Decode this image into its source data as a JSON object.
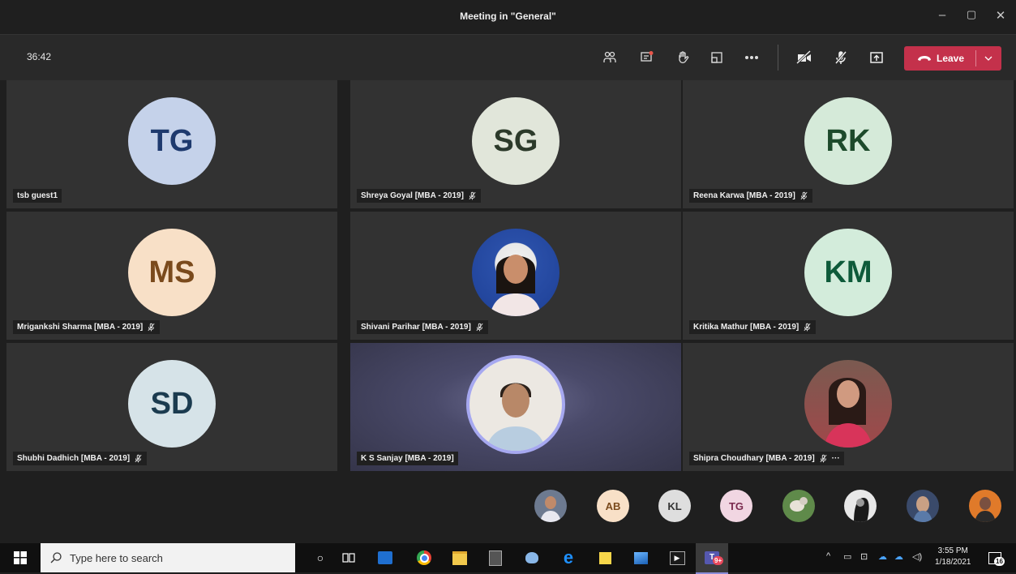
{
  "window": {
    "title": "Meeting in \"General\""
  },
  "toolbar": {
    "timer": "36:42",
    "leave_label": "Leave"
  },
  "tiles": [
    {
      "name": "tsb guest1",
      "initials": "TG",
      "bg": "#c5d2ea",
      "fg": "#1e3a6e",
      "muted": false
    },
    {
      "name": "Shreya Goyal [MBA - 2019]",
      "initials": "SG",
      "bg": "#e1e6da",
      "fg": "#2c3a2a",
      "muted": true
    },
    {
      "name": "Reena Karwa [MBA - 2019]",
      "initials": "RK",
      "bg": "#d5ead9",
      "fg": "#1d4a2b",
      "muted": true
    },
    {
      "name": "Mrigankshi Sharma [MBA - 2019]",
      "initials": "MS",
      "bg": "#f8e0c7",
      "fg": "#7a4a1c",
      "muted": true
    },
    {
      "name": "Shivani Parihar [MBA - 2019]",
      "initials": "",
      "photo": "woman-blue",
      "muted": true
    },
    {
      "name": "Kritika Mathur [MBA - 2019]",
      "initials": "KM",
      "bg": "#d3ecdb",
      "fg": "#0e5a3a",
      "muted": true
    },
    {
      "name": "Shubhi Dadhich [MBA - 2019]",
      "initials": "SD",
      "bg": "#d6e3e8",
      "fg": "#1b3b4f",
      "muted": true
    },
    {
      "name": "K S Sanjay [MBA - 2019]",
      "initials": "",
      "photo": "man-speaker",
      "muted": false
    },
    {
      "name": "Shipra Choudhary [MBA - 2019]",
      "initials": "",
      "photo": "woman-red",
      "muted": true,
      "more": "···"
    }
  ],
  "strip": [
    {
      "initials": "",
      "photo": "person-photo-1"
    },
    {
      "initials": "AB",
      "bg": "#f8e0c7",
      "fg": "#7a4a1c"
    },
    {
      "initials": "KL",
      "bg": "#dedede",
      "fg": "#333333"
    },
    {
      "initials": "TG",
      "bg": "#f1d6e2",
      "fg": "#7a2a4e"
    },
    {
      "initials": "",
      "photo": "person-photo-2"
    },
    {
      "initials": "",
      "photo": "person-photo-3"
    },
    {
      "initials": "",
      "photo": "person-photo-4"
    },
    {
      "initials": "",
      "photo": "person-photo-5"
    }
  ],
  "taskbar": {
    "search_placeholder": "Type here to search",
    "time": "3:55 PM",
    "date": "1/18/2021",
    "notifications": "16",
    "teams_badge": "9+"
  },
  "colors": {
    "leave": "#c4314b",
    "tile": "#323232",
    "accent": "#6264a7"
  }
}
